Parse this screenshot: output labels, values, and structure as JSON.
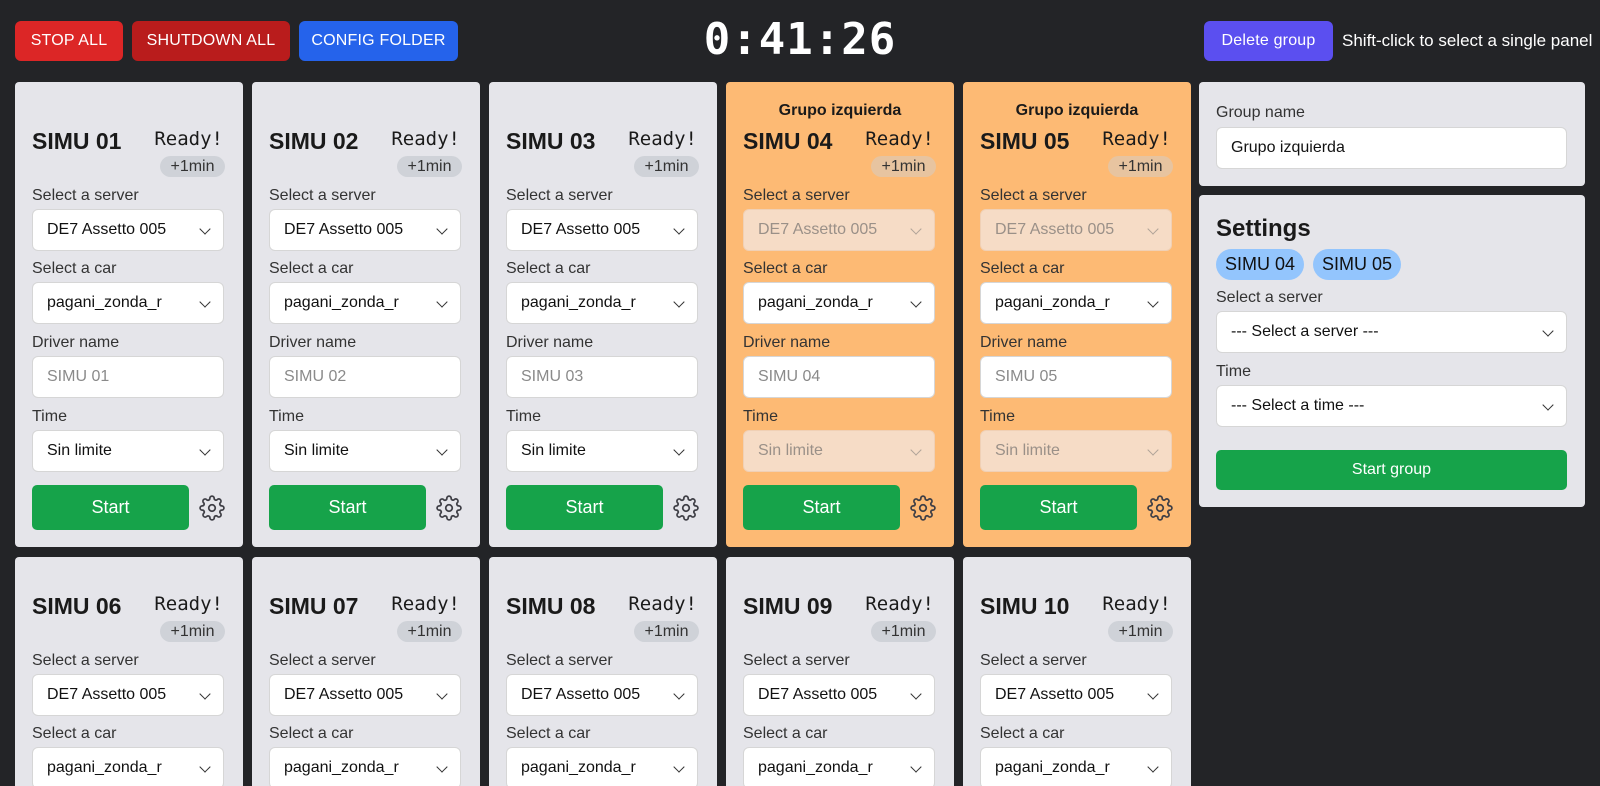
{
  "topbar": {
    "stop_all": "STOP ALL",
    "shutdown_all": "SHUTDOWN ALL",
    "config_folder": "CONFIG FOLDER",
    "timer": "0:41:26",
    "delete_group": "Delete group",
    "hint": "Shift-click to select a single panel"
  },
  "labels": {
    "server": "Select a server",
    "car": "Select a car",
    "driver": "Driver name",
    "time": "Time",
    "start": "Start"
  },
  "panels": [
    {
      "name": "SIMU 01",
      "status": "Ready!",
      "extra": "+1min",
      "server": "DE7 Assetto 005",
      "car": "pagani_zonda_r",
      "driver_placeholder": "SIMU 01",
      "time": "Sin limite",
      "group": ""
    },
    {
      "name": "SIMU 02",
      "status": "Ready!",
      "extra": "+1min",
      "server": "DE7 Assetto 005",
      "car": "pagani_zonda_r",
      "driver_placeholder": "SIMU 02",
      "time": "Sin limite",
      "group": ""
    },
    {
      "name": "SIMU 03",
      "status": "Ready!",
      "extra": "+1min",
      "server": "DE7 Assetto 005",
      "car": "pagani_zonda_r",
      "driver_placeholder": "SIMU 03",
      "time": "Sin limite",
      "group": ""
    },
    {
      "name": "SIMU 04",
      "status": "Ready!",
      "extra": "+1min",
      "server": "DE7 Assetto 005",
      "car": "pagani_zonda_r",
      "driver_placeholder": "SIMU 04",
      "time": "Sin limite",
      "group": "Grupo izquierda"
    },
    {
      "name": "SIMU 05",
      "status": "Ready!",
      "extra": "+1min",
      "server": "DE7 Assetto 005",
      "car": "pagani_zonda_r",
      "driver_placeholder": "SIMU 05",
      "time": "Sin limite",
      "group": "Grupo izquierda"
    },
    {
      "name": "SIMU 06",
      "status": "Ready!",
      "extra": "+1min",
      "server": "DE7 Assetto 005",
      "car": "pagani_zonda_r"
    },
    {
      "name": "SIMU 07",
      "status": "Ready!",
      "extra": "+1min",
      "server": "DE7 Assetto 005",
      "car": "pagani_zonda_r"
    },
    {
      "name": "SIMU 08",
      "status": "Ready!",
      "extra": "+1min",
      "server": "DE7 Assetto 005",
      "car": "pagani_zonda_r"
    },
    {
      "name": "SIMU 09",
      "status": "Ready!",
      "extra": "+1min",
      "server": "DE7 Assetto 005",
      "car": "pagani_zonda_r"
    },
    {
      "name": "SIMU 10",
      "status": "Ready!",
      "extra": "+1min",
      "server": "DE7 Assetto 005",
      "car": "pagani_zonda_r"
    }
  ],
  "group_panel": {
    "label": "Group name",
    "value": "Grupo izquierda"
  },
  "settings": {
    "title": "Settings",
    "chips": [
      "SIMU 04",
      "SIMU 05"
    ],
    "server_label": "Select a server",
    "server_value": "--- Select a server ---",
    "time_label": "Time",
    "time_value": "--- Select a time ---",
    "start_group": "Start group"
  },
  "colors": {
    "background": "#232427",
    "panel": "#e5e5ea",
    "grouped_panel": "#fdba74",
    "start": "#16a34a",
    "stop": "#dc2626",
    "shutdown": "#b91c1c",
    "config": "#2563eb",
    "delete_group": "#5b4ff0",
    "chip": "#93c5fd"
  },
  "icons": {
    "settings": "gear-icon",
    "dropdown": "chevron-down-icon"
  }
}
